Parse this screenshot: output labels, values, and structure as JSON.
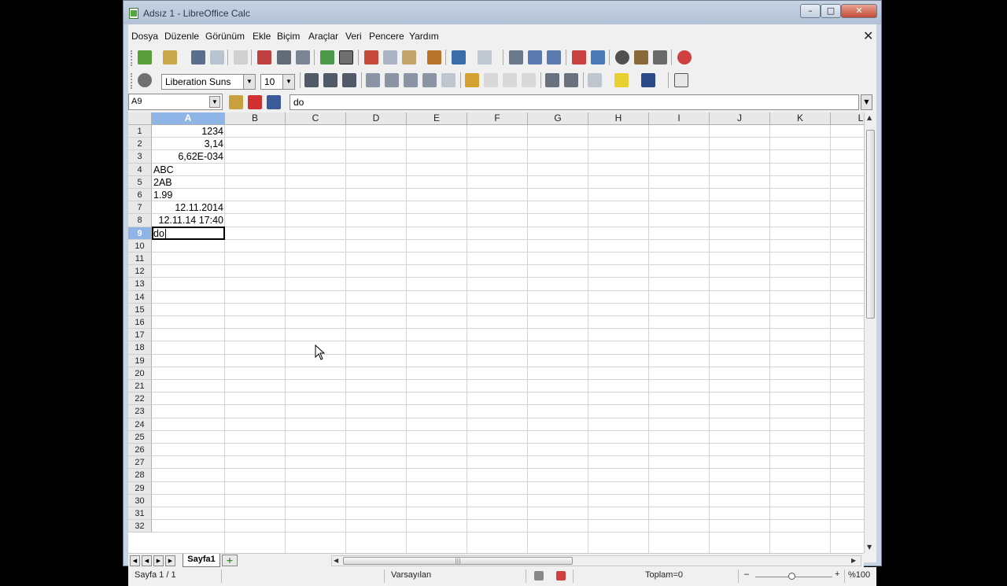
{
  "window": {
    "title": "Adsız 1 - LibreOffice Calc",
    "min_label": "–",
    "max_label": "□",
    "close_label": "✕"
  },
  "menu": {
    "items": [
      "Dosya",
      "Düzenle",
      "Görünüm",
      "Ekle",
      "Biçim",
      "Araçlar",
      "Veri",
      "Pencere",
      "Yardım"
    ],
    "doc_close": "✕"
  },
  "toolbar": {
    "font_name": "Liberation Suns",
    "font_size": "10"
  },
  "formula_bar": {
    "name_box": "A9",
    "content": "do"
  },
  "sheet": {
    "columns": [
      "A",
      "B",
      "C",
      "D",
      "E",
      "F",
      "G",
      "H",
      "I",
      "J",
      "K",
      "L"
    ],
    "active_column": "A",
    "rows": [
      "1",
      "2",
      "3",
      "4",
      "5",
      "6",
      "7",
      "8",
      "9",
      "10",
      "11",
      "12",
      "13",
      "14",
      "15",
      "16",
      "17",
      "18",
      "19",
      "20",
      "21",
      "22",
      "23",
      "24",
      "25",
      "26",
      "27",
      "28",
      "29",
      "30",
      "31",
      "32"
    ],
    "active_row": "9",
    "cells": [
      {
        "ref": "A1",
        "row": 1,
        "value": "1234",
        "align": "right"
      },
      {
        "ref": "A2",
        "row": 2,
        "value": "3,14",
        "align": "right"
      },
      {
        "ref": "A3",
        "row": 3,
        "value": "6,62E-034",
        "align": "right"
      },
      {
        "ref": "A4",
        "row": 4,
        "value": "ABC",
        "align": "left"
      },
      {
        "ref": "A5",
        "row": 5,
        "value": "2AB",
        "align": "left"
      },
      {
        "ref": "A6",
        "row": 6,
        "value": "1.99",
        "align": "left"
      },
      {
        "ref": "A7",
        "row": 7,
        "value": "12.11.2014",
        "align": "right"
      },
      {
        "ref": "A8",
        "row": 8,
        "value": "12.11.14 17:40",
        "align": "right"
      },
      {
        "ref": "A9",
        "row": 9,
        "value": "do",
        "align": "left"
      }
    ]
  },
  "tabs": {
    "sheet_name": "Sayfa1",
    "add_label": "+"
  },
  "status": {
    "page": "Sayfa 1 / 1",
    "style": "Varsayılan",
    "sum": "Toplam=0",
    "zoom_minus": "–",
    "zoom_plus": "+",
    "zoom": "%100"
  }
}
